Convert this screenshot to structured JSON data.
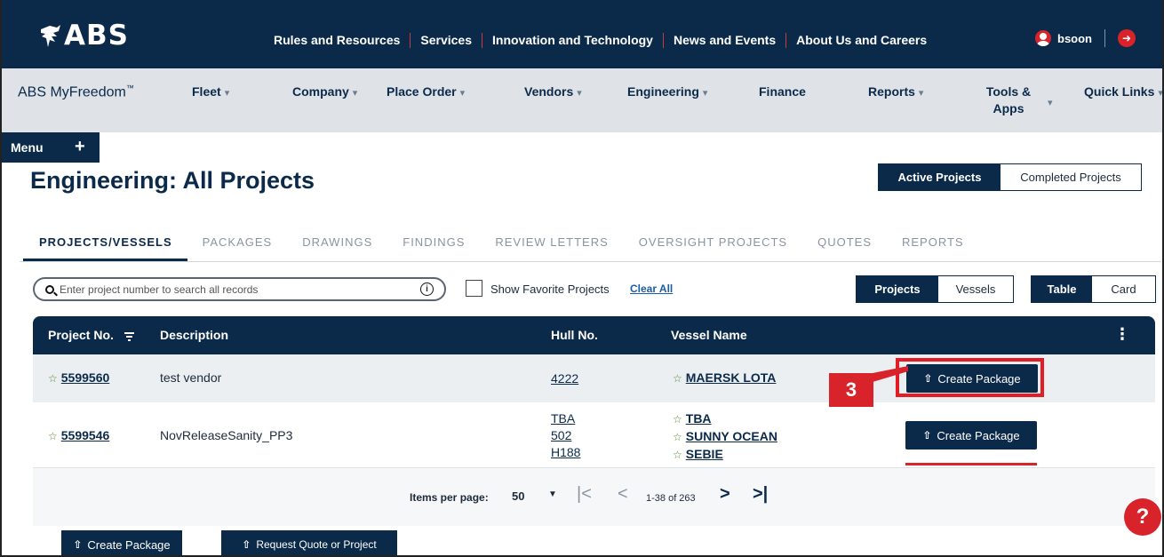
{
  "header": {
    "logo_text": "ABS",
    "links": [
      "Rules and Resources",
      "Services",
      "Innovation and Technology",
      "News and Events",
      "About Us and Careers"
    ],
    "username": "bsoon"
  },
  "nav": {
    "brand": "ABS MyFreedom",
    "brand_tm": "™",
    "items": [
      {
        "label": "Fleet",
        "caret": "▾"
      },
      {
        "label": "Company",
        "caret": "▾"
      },
      {
        "label": "Place Order",
        "caret": "▾"
      },
      {
        "label": "Vendors",
        "caret": "▾"
      },
      {
        "label": "Engineering",
        "caret": "▾"
      },
      {
        "label": "Finance",
        "caret": ""
      },
      {
        "label": "Reports",
        "caret": "▾"
      },
      {
        "label": "Tools & Apps",
        "caret": "▾"
      },
      {
        "label": "Quick Links",
        "caret": "▾"
      }
    ]
  },
  "menu": {
    "label": "Menu",
    "plus": "+"
  },
  "page": {
    "title": "Engineering: All Projects",
    "status_toggle": {
      "active": "Active Projects",
      "completed": "Completed Projects"
    }
  },
  "tabs": [
    "PROJECTS/VESSELS",
    "PACKAGES",
    "DRAWINGS",
    "FINDINGS",
    "REVIEW LETTERS",
    "OVERSIGHT PROJECTS",
    "QUOTES",
    "REPORTS"
  ],
  "search": {
    "placeholder": "Enter project number to search all records",
    "value": ""
  },
  "filters": {
    "favorites_label": "Show Favorite Projects",
    "favorites_checked": false,
    "clear_all": "Clear All",
    "view_toggle": {
      "projects": "Projects",
      "vessels": "Vessels"
    },
    "layout_toggle": {
      "table": "Table",
      "card": "Card"
    }
  },
  "table": {
    "columns": [
      "Project No.",
      "Description",
      "Hull No.",
      "Vessel Name"
    ],
    "kebab": "⋮",
    "rows": [
      {
        "project_no": "5599560",
        "description": "test vendor",
        "hulls": [
          "4222"
        ],
        "vessels": [
          "MAERSK LOTA"
        ],
        "action": "Create Package"
      },
      {
        "project_no": "5599546",
        "description": "NovReleaseSanity_PP3",
        "hulls": [
          "TBA",
          "502",
          "H188"
        ],
        "vessels": [
          "TBA",
          "SUNNY OCEAN",
          "SEBIE"
        ],
        "action": "Create Package"
      }
    ]
  },
  "pagination": {
    "items_per_page_label": "Items per page:",
    "items_per_page": "50",
    "range": "1-38 of 263"
  },
  "annotation": {
    "step": "3"
  },
  "bottom_actions": {
    "create_package": "Create Package",
    "request_quote": "Request Quote or Project"
  },
  "help": {
    "label": "?"
  },
  "colors": {
    "navy": "#0b2a4a",
    "accent_red": "#d8232a",
    "star_green": "#4f8a2b",
    "link_blue": "#1b5fa8"
  }
}
